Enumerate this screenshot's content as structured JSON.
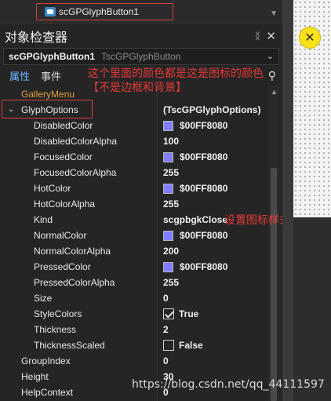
{
  "tree": {
    "node_label": "scGPGlyphButton1"
  },
  "panel": {
    "title": "对象检查器",
    "pin_glyph": "ᛝ",
    "close_glyph": "✕"
  },
  "selector": {
    "object_name": "scGPGlyphButton1",
    "object_type": "TscGPGlyphButton",
    "chevron": "⌄"
  },
  "tabs": [
    {
      "label": "属性",
      "active": true
    },
    {
      "label": "事件",
      "active": false
    }
  ],
  "search_icon": "⚲",
  "annotations": {
    "top": "这个里面的颜色都是这是图标的颜色【不是边框和背景】",
    "kind": "设置图标样式"
  },
  "properties": [
    {
      "name": "GalleryMenu",
      "value": "",
      "indent": 0,
      "style": "orange"
    },
    {
      "name": "GlyphOptions",
      "value": "(TscGPGlyphOptions)",
      "indent": 0,
      "expanded": true
    },
    {
      "name": "DisabledColor",
      "value": "$00FF8080",
      "indent": 1,
      "swatch": "#8080ff"
    },
    {
      "name": "DisabledColorAlpha",
      "value": "100",
      "indent": 1
    },
    {
      "name": "FocusedColor",
      "value": "$00FF8080",
      "indent": 1,
      "swatch": "#8080ff"
    },
    {
      "name": "FocusedColorAlpha",
      "value": "255",
      "indent": 1
    },
    {
      "name": "HotColor",
      "value": "$00FF8080",
      "indent": 1,
      "swatch": "#8080ff"
    },
    {
      "name": "HotColorAlpha",
      "value": "255",
      "indent": 1
    },
    {
      "name": "Kind",
      "value": "scgpbgkClose",
      "indent": 1
    },
    {
      "name": "NormalColor",
      "value": "$00FF8080",
      "indent": 1,
      "swatch": "#8080ff"
    },
    {
      "name": "NormalColorAlpha",
      "value": "200",
      "indent": 1
    },
    {
      "name": "PressedColor",
      "value": "$00FF8080",
      "indent": 1,
      "swatch": "#8080ff"
    },
    {
      "name": "PressedColorAlpha",
      "value": "255",
      "indent": 1
    },
    {
      "name": "Size",
      "value": "0",
      "indent": 1
    },
    {
      "name": "StyleColors",
      "value": "True",
      "indent": 1,
      "checkbox": true,
      "checked": true
    },
    {
      "name": "Thickness",
      "value": "2",
      "indent": 1
    },
    {
      "name": "ThicknessScaled",
      "value": "False",
      "indent": 1,
      "checkbox": true,
      "checked": false
    },
    {
      "name": "GroupIndex",
      "value": "0",
      "indent": 0
    },
    {
      "name": "Height",
      "value": "30",
      "indent": 0
    },
    {
      "name": "HelpContext",
      "value": "0",
      "indent": 0
    }
  ],
  "designer": {
    "close_glyph": "✕"
  },
  "watermark": "https://blog.csdn.net/qq_44111597",
  "colors": {
    "accent": "#6fb6ff",
    "annotation": "#e53935",
    "swatch": "#8080ff",
    "highlight_box": "#d94040"
  }
}
